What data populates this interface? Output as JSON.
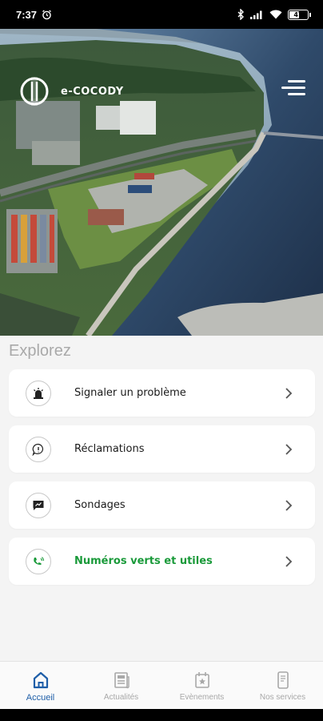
{
  "status": {
    "time": "7:37",
    "battery": "47"
  },
  "header": {
    "app_name": "e-COCODY"
  },
  "explore": {
    "title": "Explorez",
    "items": [
      {
        "label": "Signaler un problème",
        "icon": "siren-icon"
      },
      {
        "label": "Réclamations",
        "icon": "chat-question-icon"
      },
      {
        "label": "Sondages",
        "icon": "chat-poll-icon"
      },
      {
        "label": "Numéros verts et utiles",
        "icon": "phone-call-icon",
        "color": "#1a9a3a"
      }
    ]
  },
  "bottom_nav": {
    "items": [
      {
        "label": "Accueil",
        "icon": "home-icon",
        "active": true
      },
      {
        "label": "Actualités",
        "icon": "news-icon"
      },
      {
        "label": "Evènements",
        "icon": "calendar-star-icon"
      },
      {
        "label": "Nos services",
        "icon": "phone-device-icon"
      }
    ]
  },
  "colors": {
    "accent": "#1e5ea8",
    "green": "#1a9a3a",
    "background": "#f4f4f4"
  }
}
